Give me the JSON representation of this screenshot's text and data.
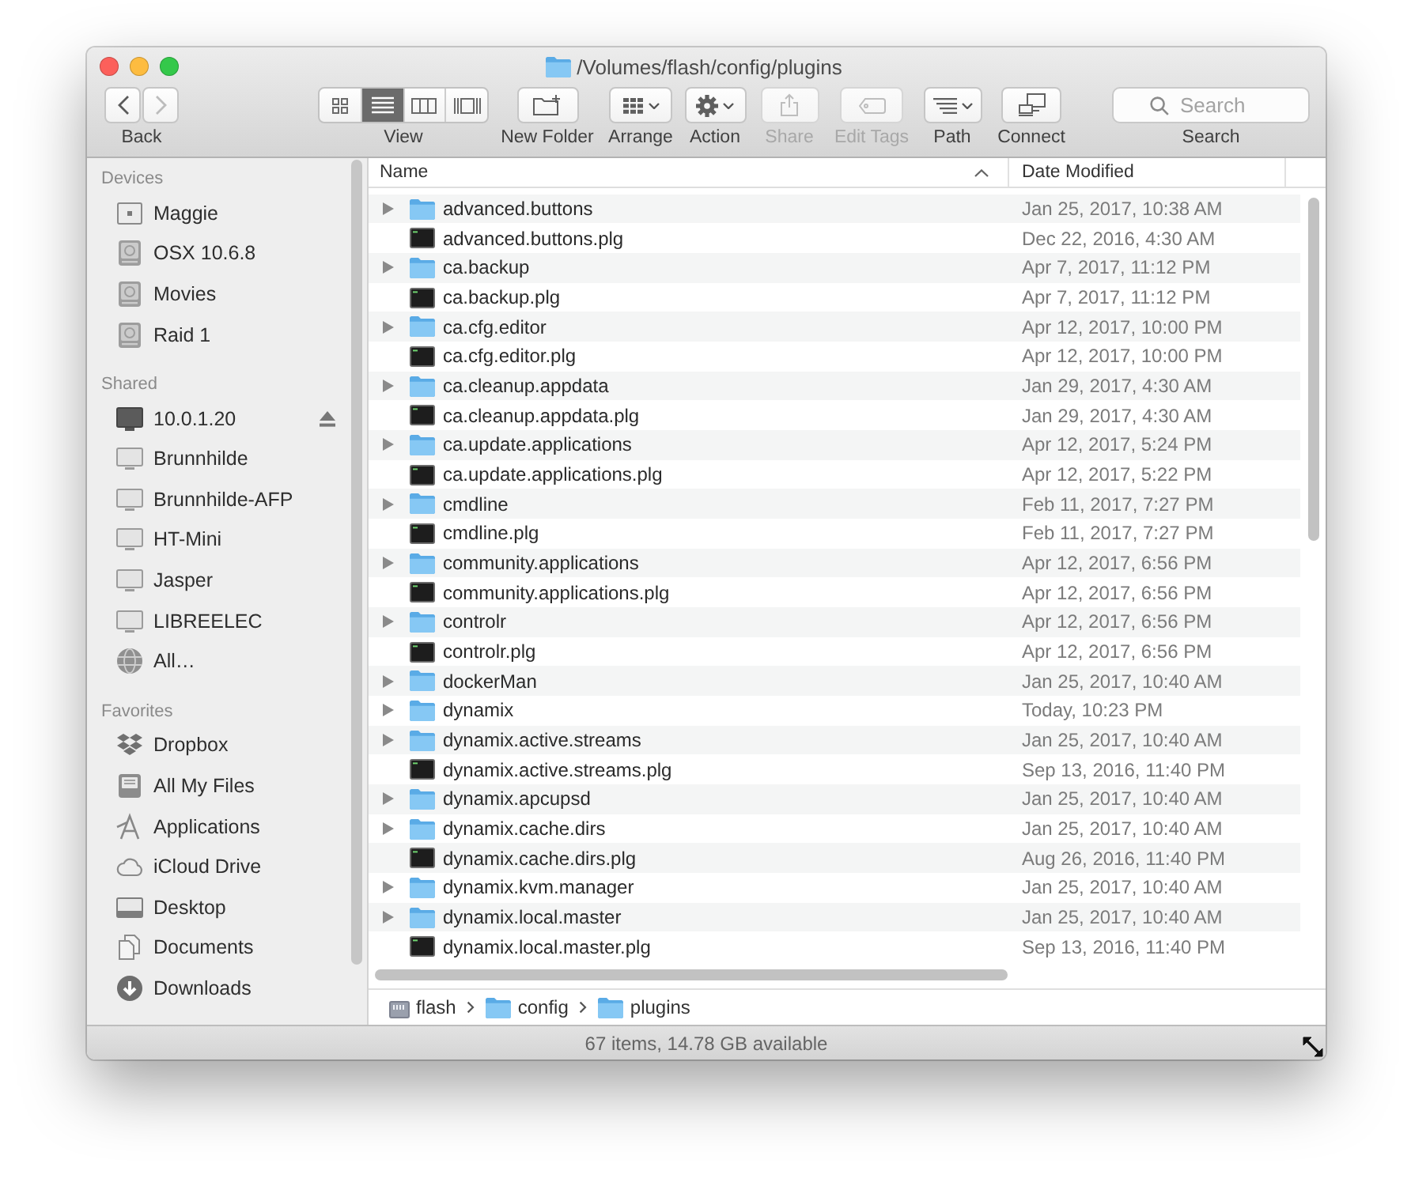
{
  "window": {
    "title": "/Volumes/flash/config/plugins"
  },
  "toolbar": {
    "navigation": {
      "label": "Back",
      "buttons": [
        {
          "kind": "back",
          "disabled": false
        },
        {
          "kind": "forward",
          "disabled": true
        }
      ]
    },
    "view": {
      "label": "View",
      "modes": [
        {
          "kind": "icon",
          "selected": false
        },
        {
          "kind": "list",
          "selected": true
        },
        {
          "kind": "column",
          "selected": false
        },
        {
          "kind": "gallery",
          "selected": false
        }
      ]
    },
    "buttons": [
      {
        "kind": "new_folder",
        "label": "New Folder",
        "disabled": false
      },
      {
        "kind": "arrange",
        "label": "Arrange",
        "disabled": false
      },
      {
        "kind": "action",
        "label": "Action",
        "disabled": false
      },
      {
        "kind": "share",
        "label": "Share",
        "disabled": true
      },
      {
        "kind": "edit_tags",
        "label": "Edit Tags",
        "disabled": true
      },
      {
        "kind": "path",
        "label": "Path",
        "disabled": false
      },
      {
        "kind": "connect",
        "label": "Connect",
        "disabled": false
      }
    ],
    "search": {
      "placeholder": "Search",
      "label": "Search"
    }
  },
  "sidebar": {
    "sections": [
      {
        "title": "Devices",
        "items": [
          {
            "kind": "device",
            "name": "Maggie",
            "ejectable": false
          },
          {
            "kind": "disk",
            "name": "OSX 10.6.8",
            "ejectable": false
          },
          {
            "kind": "disk",
            "name": "Movies",
            "ejectable": false
          },
          {
            "kind": "disk",
            "name": "Raid 1",
            "ejectable": false
          }
        ]
      },
      {
        "title": "Shared",
        "items": [
          {
            "kind": "server_connected",
            "name": "10.0.1.20",
            "ejectable": true
          },
          {
            "kind": "server",
            "name": "Brunnhilde",
            "ejectable": false
          },
          {
            "kind": "server",
            "name": "Brunnhilde-AFP",
            "ejectable": false
          },
          {
            "kind": "server",
            "name": "HT-Mini",
            "ejectable": false
          },
          {
            "kind": "server",
            "name": "Jasper",
            "ejectable": false
          },
          {
            "kind": "server",
            "name": "LIBREELEC",
            "ejectable": false
          },
          {
            "kind": "network",
            "name": "All…",
            "ejectable": false
          }
        ]
      },
      {
        "title": "Favorites",
        "items": [
          {
            "kind": "dropbox",
            "name": "Dropbox",
            "ejectable": false
          },
          {
            "kind": "all_files",
            "name": "All My Files",
            "ejectable": false
          },
          {
            "kind": "applications",
            "name": "Applications",
            "ejectable": false
          },
          {
            "kind": "icloud",
            "name": "iCloud Drive",
            "ejectable": false
          },
          {
            "kind": "desktop",
            "name": "Desktop",
            "ejectable": false
          },
          {
            "kind": "documents",
            "name": "Documents",
            "ejectable": false
          },
          {
            "kind": "downloads",
            "name": "Downloads",
            "ejectable": false
          }
        ]
      }
    ]
  },
  "table": {
    "columns": [
      {
        "label": "Name",
        "sorted": true
      },
      {
        "label": "Date Modified",
        "sorted": false
      }
    ],
    "rows": [
      {
        "kind": "folder",
        "name": "advanced.buttons",
        "date": "Jan 25, 2017, 10:38 AM"
      },
      {
        "kind": "file",
        "name": "advanced.buttons.plg",
        "date": "Dec 22, 2016, 4:30 AM"
      },
      {
        "kind": "folder",
        "name": "ca.backup",
        "date": "Apr 7, 2017, 11:12 PM"
      },
      {
        "kind": "file",
        "name": "ca.backup.plg",
        "date": "Apr 7, 2017, 11:12 PM"
      },
      {
        "kind": "folder",
        "name": "ca.cfg.editor",
        "date": "Apr 12, 2017, 10:00 PM"
      },
      {
        "kind": "file",
        "name": "ca.cfg.editor.plg",
        "date": "Apr 12, 2017, 10:00 PM"
      },
      {
        "kind": "folder",
        "name": "ca.cleanup.appdata",
        "date": "Jan 29, 2017, 4:30 AM"
      },
      {
        "kind": "file",
        "name": "ca.cleanup.appdata.plg",
        "date": "Jan 29, 2017, 4:30 AM"
      },
      {
        "kind": "folder",
        "name": "ca.update.applications",
        "date": "Apr 12, 2017, 5:24 PM"
      },
      {
        "kind": "file",
        "name": "ca.update.applications.plg",
        "date": "Apr 12, 2017, 5:22 PM"
      },
      {
        "kind": "folder",
        "name": "cmdline",
        "date": "Feb 11, 2017, 7:27 PM"
      },
      {
        "kind": "file",
        "name": "cmdline.plg",
        "date": "Feb 11, 2017, 7:27 PM"
      },
      {
        "kind": "folder",
        "name": "community.applications",
        "date": "Apr 12, 2017, 6:56 PM"
      },
      {
        "kind": "file",
        "name": "community.applications.plg",
        "date": "Apr 12, 2017, 6:56 PM"
      },
      {
        "kind": "folder",
        "name": "controlr",
        "date": "Apr 12, 2017, 6:56 PM"
      },
      {
        "kind": "file",
        "name": "controlr.plg",
        "date": "Apr 12, 2017, 6:56 PM"
      },
      {
        "kind": "folder",
        "name": "dockerMan",
        "date": "Jan 25, 2017, 10:40 AM"
      },
      {
        "kind": "folder",
        "name": "dynamix",
        "date": "Today, 10:23 PM"
      },
      {
        "kind": "folder",
        "name": "dynamix.active.streams",
        "date": "Jan 25, 2017, 10:40 AM"
      },
      {
        "kind": "file",
        "name": "dynamix.active.streams.plg",
        "date": "Sep 13, 2016, 11:40 PM"
      },
      {
        "kind": "folder",
        "name": "dynamix.apcupsd",
        "date": "Jan 25, 2017, 10:40 AM"
      },
      {
        "kind": "folder",
        "name": "dynamix.cache.dirs",
        "date": "Jan 25, 2017, 10:40 AM"
      },
      {
        "kind": "file",
        "name": "dynamix.cache.dirs.plg",
        "date": "Aug 26, 2016, 11:40 PM"
      },
      {
        "kind": "folder",
        "name": "dynamix.kvm.manager",
        "date": "Jan 25, 2017, 10:40 AM"
      },
      {
        "kind": "folder",
        "name": "dynamix.local.master",
        "date": "Jan 25, 2017, 10:40 AM"
      },
      {
        "kind": "file",
        "name": "dynamix.local.master.plg",
        "date": "Sep 13, 2016, 11:40 PM"
      }
    ]
  },
  "path_bar": [
    {
      "kind": "drive",
      "label": "flash"
    },
    {
      "kind": "folder",
      "label": "config"
    },
    {
      "kind": "folder",
      "label": "plugins"
    }
  ],
  "status_bar": {
    "text": "67 items, 14.78 GB available"
  }
}
